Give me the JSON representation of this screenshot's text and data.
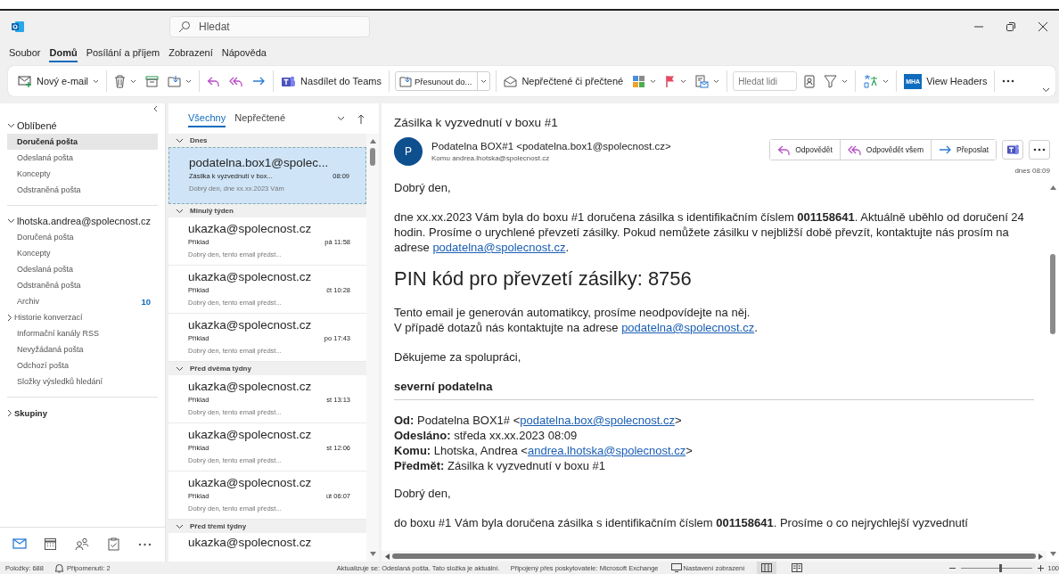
{
  "window": {
    "search_placeholder": "Hledat"
  },
  "menu_tabs": [
    {
      "label": "Soubor",
      "selected": false
    },
    {
      "label": "Domů",
      "selected": true
    },
    {
      "label": "Posílání a příjem",
      "selected": false
    },
    {
      "label": "Zobrazení",
      "selected": false
    },
    {
      "label": "Nápověda",
      "selected": false
    }
  ],
  "ribbon": [
    {
      "kind": "new-mail",
      "label": "Nový e-mail",
      "dropdown": true
    },
    {
      "kind": "separator"
    },
    {
      "kind": "delete",
      "dropdown": true
    },
    {
      "kind": "archive",
      "dropdown": false
    },
    {
      "kind": "move",
      "dropdown": true
    },
    {
      "kind": "separator"
    },
    {
      "kind": "reply",
      "dropdown": false
    },
    {
      "kind": "reply-all",
      "dropdown": false
    },
    {
      "kind": "forward",
      "dropdown": false
    },
    {
      "kind": "separator"
    },
    {
      "kind": "teams-share",
      "label": "Nasdílet do Teams",
      "dropdown": false
    },
    {
      "kind": "separator"
    },
    {
      "kind": "move-to",
      "label": "Přesunout do...",
      "dropdown": true
    },
    {
      "kind": "separator"
    },
    {
      "kind": "read-unread",
      "label": "Nepřečtené či přečtené",
      "dropdown": false
    },
    {
      "kind": "categorize",
      "dropdown": true
    },
    {
      "kind": "flag",
      "dropdown": true
    },
    {
      "kind": "rules",
      "dropdown": true
    },
    {
      "kind": "separator"
    },
    {
      "kind": "people-search",
      "placeholder": "Hledat lidi"
    },
    {
      "kind": "address-book",
      "dropdown": false
    },
    {
      "kind": "filter",
      "dropdown": true
    },
    {
      "kind": "separator"
    },
    {
      "kind": "translate",
      "dropdown": true
    },
    {
      "kind": "separator"
    },
    {
      "kind": "view-headers",
      "badge": "MHA",
      "label": "View Headers",
      "dropdown": false
    },
    {
      "kind": "separator"
    },
    {
      "kind": "more",
      "dropdown": false
    }
  ],
  "folders": [
    {
      "label": "Oblíbené",
      "expanded": true,
      "items": [
        {
          "label": "Doručená pošta",
          "selected": true
        },
        {
          "label": "Odeslaná pošta",
          "selected": false
        },
        {
          "label": "Koncepty",
          "selected": false
        },
        {
          "label": "Odstraněná pošta",
          "selected": false
        }
      ]
    },
    {
      "label": "lhotska.andrea@spolecnost.cz",
      "expanded": true,
      "items": [
        {
          "label": "Doručená pošta",
          "selected": false
        },
        {
          "label": "Koncepty",
          "selected": false
        },
        {
          "label": "Odeslaná pošta",
          "selected": false
        },
        {
          "label": "Odstraněná pošta",
          "selected": false
        },
        {
          "label": "Archiv",
          "count": "10",
          "selected": false
        },
        {
          "label": "Historie konverzací",
          "expanded": false,
          "selected": false
        },
        {
          "label": "Informační kanály RSS",
          "selected": false
        },
        {
          "label": "Nevyžádaná pošta",
          "selected": false
        },
        {
          "label": "Odchozí pošta",
          "selected": false
        },
        {
          "label": "Složky výsledků hledání",
          "selected": false
        }
      ]
    },
    {
      "label": "Skupiny",
      "expanded": false
    }
  ],
  "nav": [
    {
      "kind": "mail",
      "selected": true
    },
    {
      "kind": "calendar",
      "selected": false
    },
    {
      "kind": "people",
      "selected": false
    },
    {
      "kind": "tasks",
      "selected": false
    },
    {
      "kind": "more",
      "selected": false
    }
  ],
  "message_list": {
    "filters": [
      {
        "label": "Všechny",
        "selected": true
      },
      {
        "label": "Nepřečtené",
        "selected": false
      }
    ],
    "groups": [
      {
        "label": "Dnes",
        "expanded": true,
        "messages": [
          {
            "sender": "podatelna.box1@spolec...",
            "subject": "Zásilka k vyzvednutí v box...",
            "time": "08:09",
            "preview": "Dobrý den, dne xx.xx.2023 Vám",
            "selected": true
          }
        ]
      },
      {
        "label": "Minulý týden",
        "expanded": true,
        "messages": [
          {
            "sender": "ukazka@spolecnost.cz",
            "subject": "Příklad",
            "time": "pá 11:58",
            "preview": "Dobrý den, tento email předst...",
            "selected": false
          },
          {
            "sender": "ukazka@spolecnost.cz",
            "subject": "Příklad",
            "time": "čt 10:28",
            "preview": "Dobrý den, tento email předst...",
            "selected": false
          },
          {
            "sender": "ukazka@spolecnost.cz",
            "subject": "Příklad",
            "time": "po 17:43",
            "preview": "Dobrý den, tento email předst...",
            "selected": false
          }
        ]
      },
      {
        "label": "Před dvěma týdny",
        "expanded": true,
        "messages": [
          {
            "sender": "ukazka@spolecnost.cz",
            "subject": "Příklad",
            "time": "st 13:13",
            "preview": "Dobrý den, tento email předst...",
            "selected": false
          },
          {
            "sender": "ukazka@spolecnost.cz",
            "subject": "Příklad",
            "time": "st 12:06",
            "preview": "Dobrý den, tento email předst...",
            "selected": false
          },
          {
            "sender": "ukazka@spolecnost.cz",
            "subject": "Příklad",
            "time": "út 06:07",
            "preview": "Dobrý den, tento email předst...",
            "selected": false
          }
        ]
      },
      {
        "label": "Před třemi týdny",
        "expanded": true,
        "messages": [
          {
            "sender": "ukazka@spolecnost.cz",
            "selected": false
          }
        ]
      }
    ]
  },
  "message": {
    "subject": "Zásilka k vyzvednutí v boxu #1",
    "avatar": "P",
    "from": "Podatelna BOX#1 <podatelna.box1@spolecnost.cz>",
    "to_label": "Komu",
    "to": "andrea.lhotska@spolecnost.cz",
    "actions": [
      {
        "kind": "reply",
        "label": "Odpovědět"
      },
      {
        "kind": "reply-all",
        "label": "Odpovědět všem"
      },
      {
        "kind": "forward",
        "label": "Přeposlat"
      },
      {
        "kind": "teams"
      },
      {
        "kind": "more"
      }
    ],
    "date": "dnes 08:09",
    "body": [
      {
        "kind": "paragraph",
        "lines": [
          [
            {
              "text": "Dobrý den,"
            }
          ]
        ]
      },
      {
        "kind": "paragraph",
        "lines": [
          [
            {
              "text": "dne xx.xx.2023 Vám byla do boxu #1 doručena zásilka s identifikačním číslem **001158641**. Aktuálně uběhlo od doručení 24 hodin. Prosíme o urychlené převzetí zásilky. Pokud nemůžete zásilku v nejbližší době převzít, kontaktujte nás prosím na adrese "
            },
            {
              "link": "podatelna@spolecnost.cz"
            },
            {
              "text": "."
            }
          ]
        ]
      },
      {
        "kind": "heading",
        "text": "PIN kód pro převzetí zásilky: 8756"
      },
      {
        "kind": "paragraph",
        "lines": [
          [
            {
              "text": "Tento email je generován automatikcy, prosíme neodpovídejte na něj."
            }
          ],
          [
            {
              "text": "V případě dotazů nás kontaktujte na adrese "
            },
            {
              "link": "podatelna@spolecnost.cz"
            },
            {
              "text": "."
            }
          ]
        ]
      },
      {
        "kind": "paragraph",
        "lines": [
          [
            {
              "text": "Děkujeme za spolupráci,"
            }
          ]
        ]
      },
      {
        "kind": "signature",
        "text": "severní podatelna"
      },
      {
        "kind": "rule"
      },
      {
        "kind": "header-lines",
        "lines": [
          [
            {
              "text": "**Od:** Podatelna BOX1# <"
            },
            {
              "link": "podatelna.box@spolecnost.cz"
            },
            {
              "text": ">"
            }
          ],
          [
            {
              "text": "**Odesláno:** středa xx.xx.2023 08:09"
            }
          ],
          [
            {
              "text": "**Komu:** Lhotska, Andrea <"
            },
            {
              "link": "andrea.lhotska@spolecnost.cz"
            },
            {
              "text": ">"
            }
          ],
          [
            {
              "text": "**Předmět:** Zásilka k vyzvednutí v boxu #1"
            }
          ]
        ]
      },
      {
        "kind": "paragraph",
        "lines": [
          [
            {
              "text": "Dobrý den,"
            }
          ]
        ]
      },
      {
        "kind": "paragraph",
        "lines": [
          [
            {
              "text": "do boxu #1 Vám byla doručena zásilka s identifikačním číslem **001158641**. Prosíme o co nejrychlejší vyzvednutí"
            }
          ]
        ]
      }
    ]
  },
  "status_bar": {
    "items": "Položky: 688",
    "reminders": "Připomenutí: 2",
    "sync": "Aktualizuje se: Odeslaná pošta.  Tato složka je aktuální.",
    "connection": "Připojený přes poskytovatele: Microsoft Exchange",
    "view_settings": "Nastavení zobrazení",
    "views": [
      {
        "kind": "normal",
        "selected": true
      },
      {
        "kind": "reading",
        "selected": false
      }
    ],
    "zoom": {
      "level": 0.55,
      "reading": "100"
    }
  }
}
